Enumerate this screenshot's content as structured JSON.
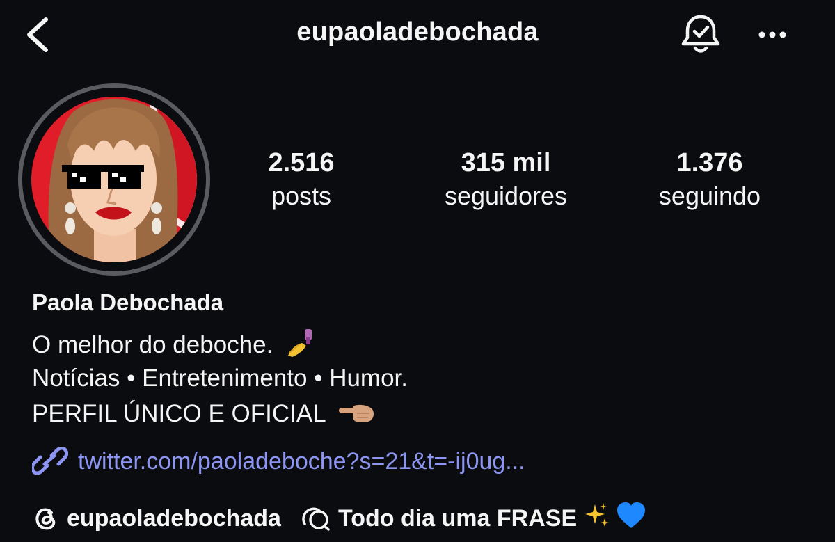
{
  "header": {
    "title": "eupaoladebochada",
    "back_icon": "chevron-left-icon",
    "bell_icon": "bell-check-icon",
    "more_icon": "more-horizontal-icon"
  },
  "stats": {
    "posts": {
      "value": "2.516",
      "label": "posts"
    },
    "followers": {
      "value": "315 mil",
      "label": "seguidores"
    },
    "following": {
      "value": "1.376",
      "label": "seguindo"
    }
  },
  "profile": {
    "name": "Paola Debochada",
    "bio": [
      "O melhor do deboche.",
      "Notícias • Entretenimento • Humor.",
      "PERFIL ÚNICO E OFICIAL"
    ],
    "link": "twitter.com/paoladeboche?s=21&t=-ij0ug...",
    "threads_handle": "eupaoladebochada",
    "note": "Todo dia uma FRASE"
  },
  "colors": {
    "background": "#0b0c10",
    "text": "#f5f5f5",
    "link": "#8d95f2",
    "ring": "#5a5b60"
  }
}
